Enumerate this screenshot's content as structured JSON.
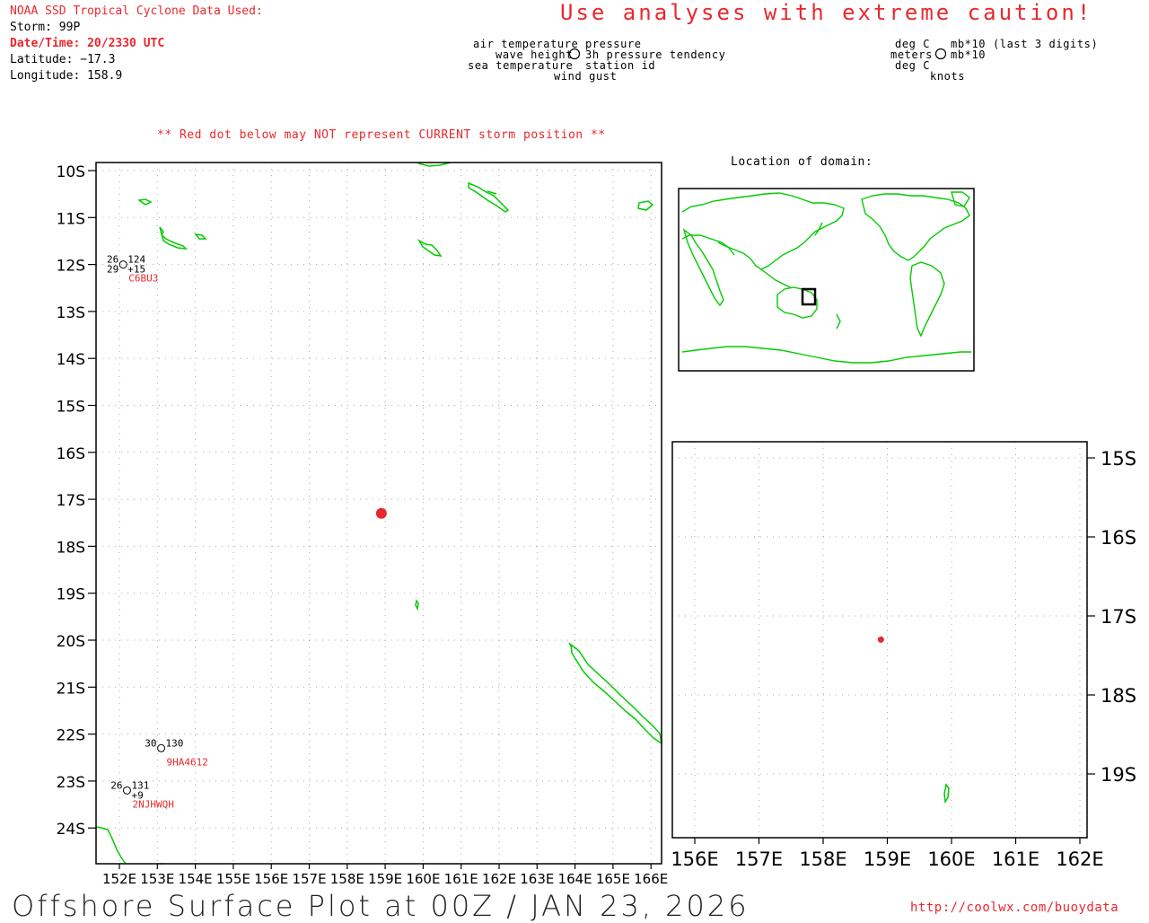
{
  "header": {
    "source": "NOAA SSD Tropical Cyclone Data Used:",
    "storm": "Storm: 99P",
    "datetime": "Date/Time: 20/2330 UTC",
    "latitude": "Latitude: −17.3",
    "longitude": "Longitude: 158.9",
    "caution": "Use analyses with extreme caution!"
  },
  "legend": {
    "air_temperature": "air temperature",
    "wave_height": "wave height",
    "sea_temperature": "sea temperature",
    "pressure": "pressure",
    "pressure_tendency": "3h pressure tendency",
    "station_id": "station id",
    "wind_gust": "wind gust",
    "deg_c_1": "deg C",
    "meters": "meters",
    "deg_c_2": "deg C",
    "mb_last3": "mb*10 (last 3 digits)",
    "mb10": "mb*10",
    "knots": "knots"
  },
  "notice": "** Red dot below may NOT represent CURRENT storm position **",
  "inset_title": "Location of domain:",
  "main_map": {
    "lat_labels": [
      "10S",
      "11S",
      "12S",
      "13S",
      "14S",
      "15S",
      "16S",
      "17S",
      "18S",
      "19S",
      "20S",
      "21S",
      "22S",
      "23S",
      "24S"
    ],
    "lon_labels": [
      "152E",
      "153E",
      "154E",
      "155E",
      "156E",
      "157E",
      "158E",
      "159E",
      "160E",
      "161E",
      "162E",
      "163E",
      "164E",
      "165E",
      "166E"
    ],
    "storm_lat": -17.3,
    "storm_lon": 158.9
  },
  "zoom_map": {
    "lat_labels": [
      "15S",
      "16S",
      "17S",
      "18S",
      "19S"
    ],
    "lon_labels": [
      "156E",
      "157E",
      "158E",
      "159E",
      "160E",
      "161E",
      "162E"
    ]
  },
  "stations": [
    {
      "id": "C6BU3",
      "air_temp": "26",
      "sea_temp": "29",
      "pressure": "124",
      "tendency": "+15",
      "lat": -12.0,
      "lon": 152.1
    },
    {
      "id": "9HA4612",
      "air_temp": "30",
      "sea_temp": "",
      "pressure": "130",
      "tendency": "",
      "lat": -22.3,
      "lon": 153.1
    },
    {
      "id": "2NJHWQH",
      "air_temp": "26",
      "sea_temp": "",
      "pressure": "131",
      "tendency": "+9",
      "lat": -23.2,
      "lon": 152.2
    }
  ],
  "footer": {
    "title": "Offshore Surface Plot at 00Z / JAN 23, 2026",
    "url": "http://coolwx.com/buoydata"
  },
  "colors": {
    "land": "#00cc00",
    "storm": "#e8282d",
    "text_red": "#e8282d",
    "grid": "#999999"
  }
}
